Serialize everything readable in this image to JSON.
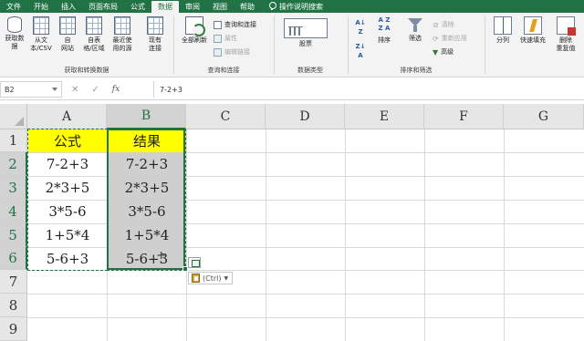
{
  "tabs": [
    "文件",
    "开始",
    "插入",
    "页面布局",
    "公式",
    "数据",
    "审阅",
    "视图",
    "帮助"
  ],
  "active_tab": "数据",
  "tell_me": "操作说明搜索",
  "ribbon": {
    "get_data": "获取数\n据",
    "from_text": "从文\n本/CSV",
    "from_web": "自\n网站",
    "from_table": "自表\n格/区域",
    "recent_sources": "最近使\n用的源",
    "existing_connections": "现有\n连接",
    "group_get_transform": "获取和转换数据",
    "refresh_all": "全部刷新",
    "queries_connections": "查询和连接",
    "properties": "属性",
    "edit_links": "编辑链接",
    "group_queries": "查询和连接",
    "stocks": "股票",
    "group_datatypes": "数据类型",
    "sort": "排序",
    "filter": "筛选",
    "clear": "清除",
    "reapply": "重新应用",
    "advanced": "高级",
    "group_sort_filter": "排序和筛选",
    "text_to_columns": "分列",
    "flash_fill": "快速填充",
    "remove_duplicates": "删除\n重复值"
  },
  "formula_bar": {
    "name_box": "B2",
    "cancel": "✕",
    "enter": "✓",
    "fx": "fx",
    "formula": "7-2+3"
  },
  "columns": [
    "A",
    "B",
    "C",
    "D",
    "E",
    "F",
    "G"
  ],
  "rows": [
    "1",
    "2",
    "3",
    "4",
    "5",
    "6",
    "7",
    "8",
    "9"
  ],
  "cells": {
    "A1": "公式",
    "B1": "结果",
    "A2": "7-2+3",
    "B2": "7-2+3",
    "A3": "2*3+5",
    "B3": "2*3+5",
    "A4": "3*5-6",
    "B4": "3*5-6",
    "A5": "1+5*4",
    "B5": "1+5*4",
    "A6": "5-6+3",
    "B6": "5-6+3"
  },
  "paste_options_label": "(Ctrl)",
  "colors": {
    "accent": "#217346",
    "header_fill": "#ffff00",
    "selection_fill": "#cfcfcf"
  }
}
